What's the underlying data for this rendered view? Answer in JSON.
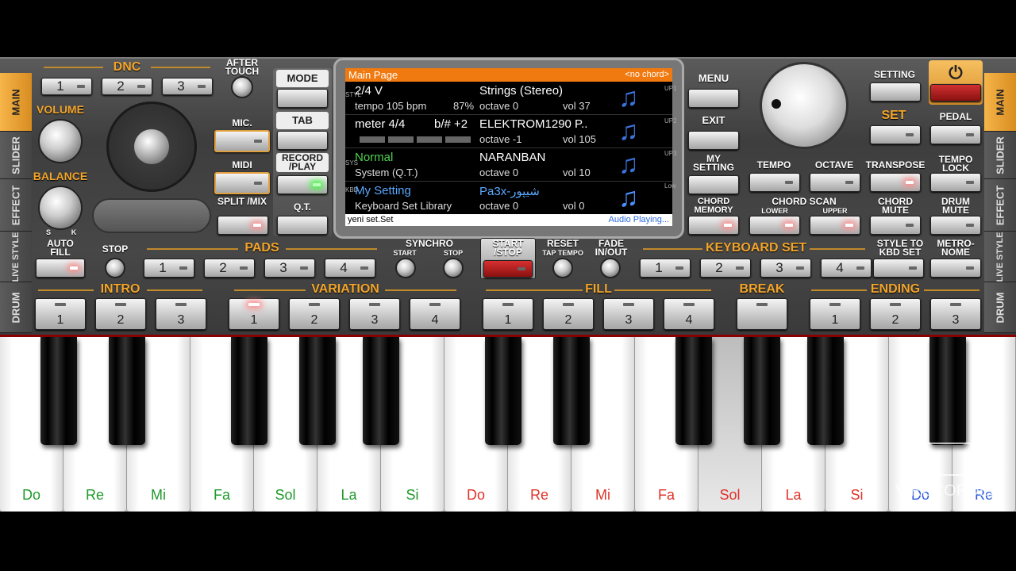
{
  "dnc": "DNC",
  "after_touch": "AFTER TOUCH",
  "volume": "VOLUME",
  "balance": "BALANCE",
  "bal_s": "S",
  "bal_k": "K",
  "dnc_buttons": [
    "1",
    "2",
    "3"
  ],
  "mic": "MIC.",
  "midi": "MIDI",
  "split_mix": "SPLIT /MIX",
  "mode": "MODE",
  "tab": "TAB",
  "record_play": "RECORD /PLAY",
  "qt": "Q.T.",
  "menu": "MENU",
  "exit": "EXIT",
  "my_setting": "MY SETTING",
  "chord_memory": "CHORD MEMORY",
  "setting": "SETTING",
  "set": "SET",
  "pedal": "PEDAL",
  "tempo": "TEMPO",
  "octave": "OCTAVE",
  "transpose": "TRANSPOSE",
  "tempo_lock": "TEMPO LOCK",
  "chord_scan": "CHORD SCAN",
  "lower": "LOWER",
  "upper": "UPPER",
  "chord_mute": "CHORD MUTE",
  "drum_mute": "DRUM MUTE",
  "left_tabs": [
    "MAIN",
    "SLIDER",
    "EFFECT",
    "LIVE STYLE",
    "DRUM"
  ],
  "right_tabs": [
    "MAIN",
    "SLIDER",
    "EFFECT",
    "LIVE STYLE",
    "DRUM"
  ],
  "auto_fill": "AUTO FILL",
  "stop": "STOP",
  "pads": "PADS",
  "pad_buttons": [
    "1",
    "2",
    "3",
    "4"
  ],
  "synchro": "SYNCHRO",
  "sync_start": "START",
  "sync_stop": "STOP",
  "start_stop": "START /STOP",
  "reset": "RESET",
  "tap_tempo": "TAP TEMPO",
  "fade": "FADE IN/OUT",
  "keyboard_set": "KEYBOARD SET",
  "kbd_buttons": [
    "1",
    "2",
    "3",
    "4"
  ],
  "style_to_kbd": "STYLE TO KBD SET",
  "metronome": "METRO- NOME",
  "intro": "INTRO",
  "intro_buttons": [
    "1",
    "2",
    "3"
  ],
  "variation": "VARIATION",
  "variation_buttons": [
    "1",
    "2",
    "3",
    "4"
  ],
  "fill": "FILL",
  "fill_buttons": [
    "1",
    "2",
    "3",
    "4"
  ],
  "break": "BREAK",
  "ending": "ENDING",
  "ending_buttons": [
    "1",
    "2",
    "3"
  ],
  "lcd": {
    "title": "Main Page",
    "chord": "<no chord>",
    "style_vert": "STYL",
    "sys_vert": "SYS",
    "kbd_vert": "KBD",
    "up1": "UP1",
    "up2": "UP2",
    "up3": "UP3",
    "low": "Low",
    "r1": {
      "a": "2/4 V",
      "b": "tempo 105 bpm",
      "c": "87%",
      "d": "Strings (Stereo)",
      "e": "octave  0",
      "f": "vol 37"
    },
    "r2": {
      "a": "meter 4/4",
      "b": "b/# +2",
      "d": "ELEKTROM1290 P..",
      "e": "octave -1",
      "f": "vol 105"
    },
    "r3": {
      "a": "Normal",
      "b": "System (Q.T.)",
      "d": "NARANBAN",
      "e": "octave  0",
      "f": "vol 10"
    },
    "r4": {
      "a": "My Setting",
      "b": "Keyboard Set Library",
      "d": "Pa3x-شیپور",
      "e": "octave  0",
      "f": "vol 0"
    },
    "footer_left": "yeni set.Set",
    "footer_right": "Audio Playing..."
  },
  "keys": [
    "Do",
    "Re",
    "Mi",
    "Fa",
    "Sol",
    "La",
    "Si",
    "Do",
    "Re",
    "Mi",
    "Fa",
    "Sol",
    "La",
    "Si",
    "Do",
    "Re"
  ],
  "key_colors": [
    "#1f9a2a",
    "#1f9a2a",
    "#1f9a2a",
    "#1f9a2a",
    "#1f9a2a",
    "#1f9a2a",
    "#1f9a2a",
    "#e0322a",
    "#e0322a",
    "#e0322a",
    "#e0322a",
    "#e0322a",
    "#e0322a",
    "#e0322a",
    "#2a5ad8",
    "#2a5ad8"
  ],
  "watermark": "V RECORDER",
  "icons": {
    "power": "power-icon",
    "note": "music-note-icon"
  }
}
